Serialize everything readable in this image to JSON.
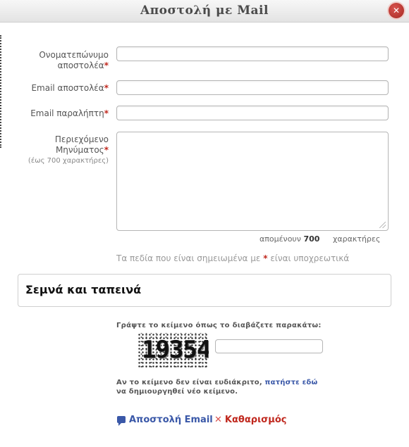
{
  "dialog": {
    "title": "Αποστολή με Mail",
    "close_symbol": "✕"
  },
  "form": {
    "sender_name_label_1": "Ονοματεπώνυμο",
    "sender_name_label_2": "αποστολέα",
    "sender_email_label": "Email αποστολέα",
    "recipient_email_label": "Email παραλήπτη",
    "message_label_1": "Περιεχόμενο",
    "message_label_2": "Μηνύματος",
    "message_hint": "(έως 700 χαρακτήρες)",
    "required_mark": "*",
    "sender_name_value": "",
    "sender_email_value": "",
    "recipient_email_value": "",
    "message_value": ""
  },
  "counter": {
    "prefix": "απομένουν",
    "value": "700",
    "suffix": "χαρακτήρες"
  },
  "required_note": {
    "before": "Τα πεδία που είναι σημειωμένα με",
    "mark": "*",
    "after": "είναι υποχρεωτικά"
  },
  "slogan": "Σεμνά και ταπεινά",
  "captcha": {
    "instruction": "Γράψτε το κείμενο όπως το διαβάζετε παρακάτω:",
    "image_text": "19354",
    "input_value": "",
    "note_before": "Αν το κείμενο δεν είναι ευδιάκριτο, ",
    "note_link": "πατήστε εδώ",
    "note_after": " να δημιουργηθεί νέο κείμενο."
  },
  "actions": {
    "send_label": "Αποστολή Email",
    "send_icon": "speech-bubble-icon",
    "clear_label": "Καθαρισμός",
    "clear_icon": "x-icon"
  },
  "colors": {
    "accent_blue": "#3a58a8",
    "required_red": "#c0281e"
  }
}
